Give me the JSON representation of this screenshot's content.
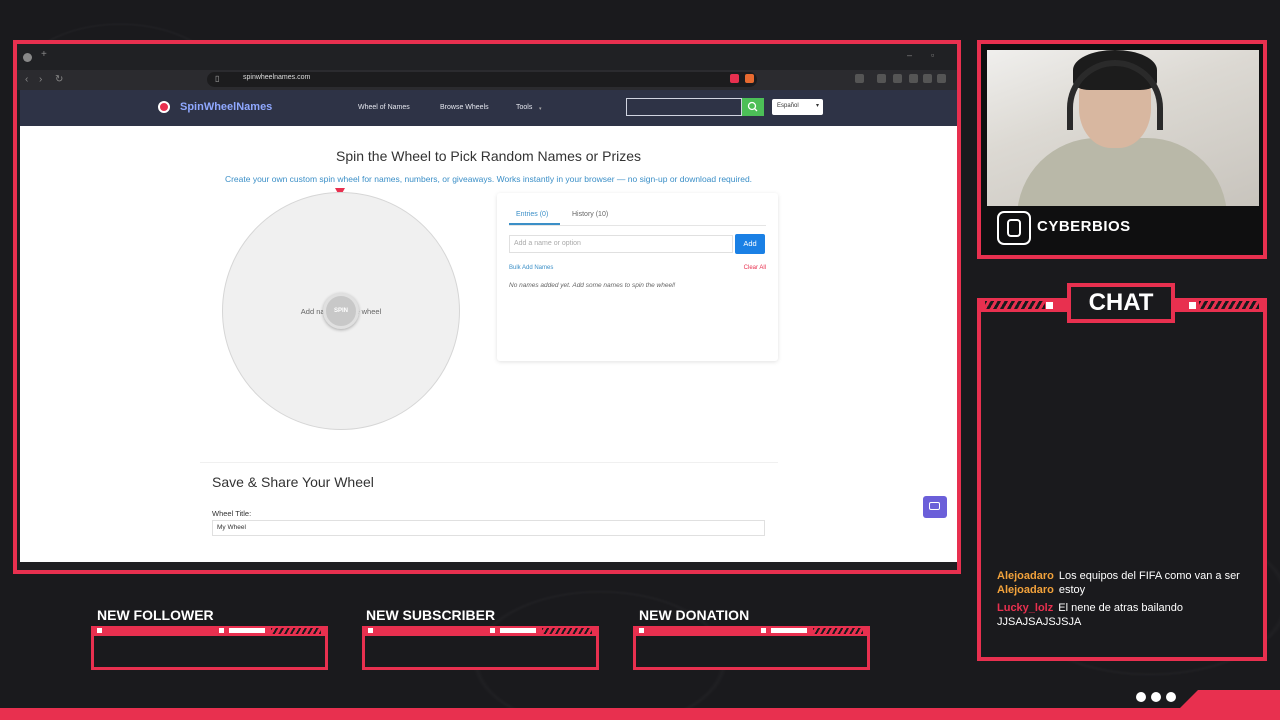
{
  "browser": {
    "url": "spinwheelnames.com"
  },
  "site": {
    "logo": "SpinWheelNames",
    "nav": [
      "Wheel of Names",
      "Browse Wheels",
      "Tools"
    ],
    "language": "Español",
    "hero_title": "Spin the Wheel to Pick Random Names or Prizes",
    "hero_subtitle": "Create your own custom spin wheel for names, numbers, or giveaways. Works instantly in your browser — no sign-up or download required.",
    "wheel_placeholder": "Add names to the wheel",
    "spin_label": "SPIN",
    "tabs": {
      "entries": "Entries (0)",
      "history": "History (10)"
    },
    "entry_placeholder": "Add a name or option",
    "add_label": "Add",
    "bulk_label": "Bulk Add Names",
    "clear_label": "Clear All",
    "empty_message": "No names added yet. Add some names to spin the wheel!",
    "save_title": "Save & Share Your Wheel",
    "wheel_title_label": "Wheel Title:",
    "wheel_title_value": "My Wheel"
  },
  "stream": {
    "brand": "CYBERBIOS",
    "chat_title": "CHAT",
    "chat_messages": [
      {
        "user": "Alejoadaro",
        "text": "Los equipos del FIFA como van a ser",
        "highlight": false
      },
      {
        "user": "Alejoadaro",
        "text": "estoy",
        "highlight": false
      },
      {
        "user": "Lucky_lolz",
        "text": "El nene de atras bailando JJSAJSAJSJSJA",
        "highlight": true
      }
    ],
    "alerts": [
      "NEW FOLLOWER",
      "NEW SUBSCRIBER",
      "NEW DONATION"
    ]
  },
  "colors": {
    "accent": "#e8304f",
    "link": "#3b8fc7",
    "add": "#1a80e5",
    "header": "#2e3346"
  }
}
